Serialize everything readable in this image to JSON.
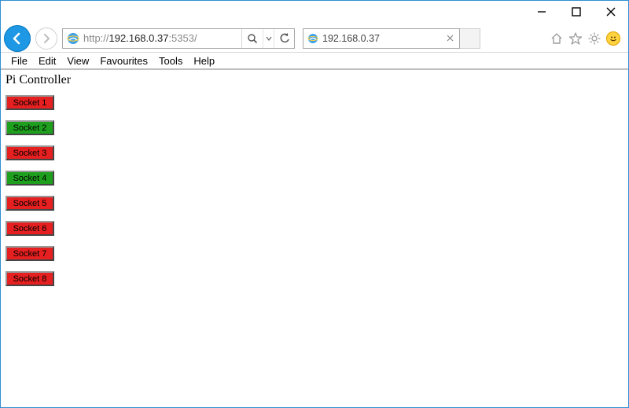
{
  "address_bar": {
    "url_dim_prefix": "http://",
    "url_host": "192.168.0.37",
    "url_dim_suffix": ":5353/"
  },
  "tab": {
    "title": "192.168.0.37"
  },
  "menu": {
    "file": "File",
    "edit": "Edit",
    "view": "View",
    "favourites": "Favourites",
    "tools": "Tools",
    "help": "Help"
  },
  "page": {
    "title": "Pi Controller",
    "sockets": [
      {
        "label": "Socket 1",
        "state": "on"
      },
      {
        "label": "Socket 2",
        "state": "off"
      },
      {
        "label": "Socket 3",
        "state": "on"
      },
      {
        "label": "Socket 4",
        "state": "off"
      },
      {
        "label": "Socket 5",
        "state": "on"
      },
      {
        "label": "Socket 6",
        "state": "on"
      },
      {
        "label": "Socket 7",
        "state": "on"
      },
      {
        "label": "Socket 8",
        "state": "on"
      }
    ]
  }
}
